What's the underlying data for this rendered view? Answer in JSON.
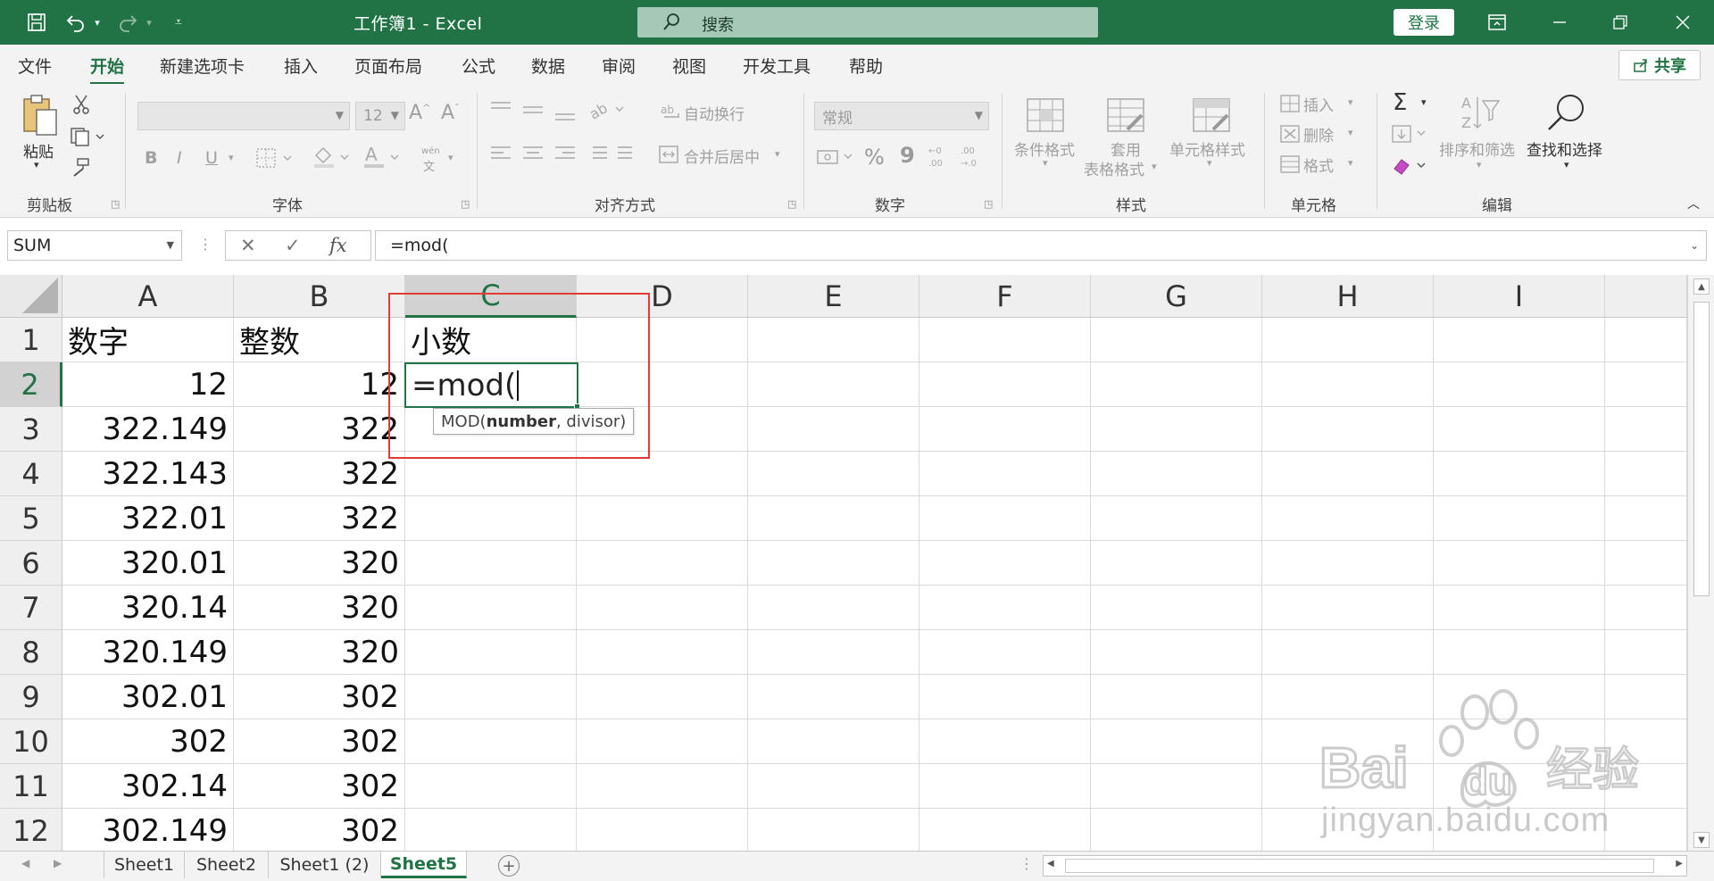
{
  "app": {
    "title": "工作簿1  -  Excel",
    "search_placeholder": "搜索",
    "login_label": "登录",
    "share_label": "共享",
    "accent_color": "#217346"
  },
  "menu": {
    "tabs": [
      "文件",
      "开始",
      "新建选项卡",
      "插入",
      "页面布局",
      "公式",
      "数据",
      "审阅",
      "视图",
      "开发工具",
      "帮助"
    ],
    "active": "开始"
  },
  "ribbon": {
    "clipboard": {
      "paste": "粘贴",
      "group": "剪贴板"
    },
    "font": {
      "font_size": "12",
      "group": "字体",
      "bold": "B",
      "italic": "I",
      "underline": "U",
      "phonetic": "wén"
    },
    "alignment": {
      "wrap": "自动换行",
      "merge": "合并后居中",
      "group": "对齐方式"
    },
    "number": {
      "format": "常规",
      "percent": "%",
      "comma": "9",
      "group": "数字"
    },
    "styles": {
      "conditional": "条件格式",
      "table_line1": "套用",
      "table_line2": "表格格式",
      "cell_styles": "单元格样式",
      "group": "样式"
    },
    "cells": {
      "insert": "插入",
      "delete": "删除",
      "format": "格式",
      "group": "单元格"
    },
    "editing": {
      "sort_filter": "排序和筛选",
      "find_select": "查找和选择",
      "group": "编辑"
    }
  },
  "formula_bar": {
    "name_box": "SUM",
    "formula": "=mod("
  },
  "grid": {
    "columns": [
      "A",
      "B",
      "C",
      "D",
      "E",
      "F",
      "G",
      "H",
      "I"
    ],
    "selected_column": "C",
    "selected_row": "2",
    "rows": [
      {
        "row": "1",
        "A": "数字",
        "B": "整数",
        "C": "小数"
      },
      {
        "row": "2",
        "A": "12",
        "B": "12",
        "C": "=mod("
      },
      {
        "row": "3",
        "A": "322.149",
        "B": "322"
      },
      {
        "row": "4",
        "A": "322.143",
        "B": "322"
      },
      {
        "row": "5",
        "A": "322.01",
        "B": "322"
      },
      {
        "row": "6",
        "A": "320.01",
        "B": "320"
      },
      {
        "row": "7",
        "A": "320.14",
        "B": "320"
      },
      {
        "row": "8",
        "A": "320.149",
        "B": "320"
      },
      {
        "row": "9",
        "A": "302.01",
        "B": "302"
      },
      {
        "row": "10",
        "A": "302",
        "B": "302"
      },
      {
        "row": "11",
        "A": "302.14",
        "B": "302"
      },
      {
        "row": "12",
        "A": "302.149",
        "B": "302"
      }
    ],
    "tooltip": {
      "fn": "MOD(",
      "arg1": "number",
      "rest": ", divisor)"
    }
  },
  "sheets": {
    "tabs": [
      "Sheet1",
      "Sheet2",
      "Sheet1 (2)",
      "Sheet5"
    ],
    "active": "Sheet5"
  },
  "watermark": {
    "text": "jingyan.baidu.com"
  },
  "icons": {
    "save": "save-icon",
    "undo": "undo-icon",
    "redo": "redo-icon",
    "search": "search-icon",
    "close": "close-icon"
  }
}
